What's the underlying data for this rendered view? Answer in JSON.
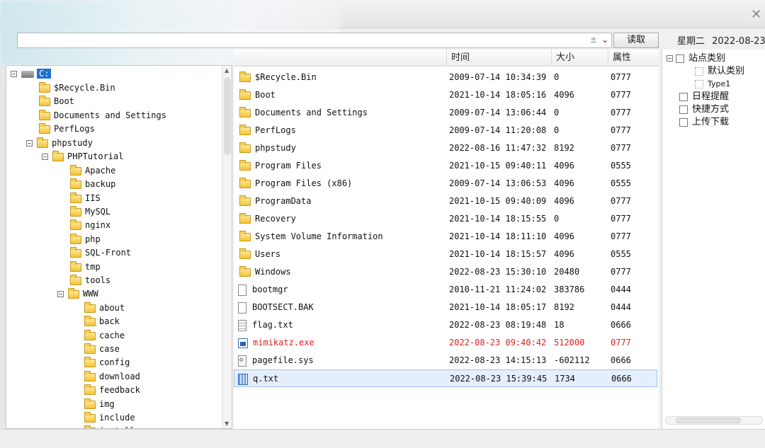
{
  "toolbar": {
    "read_label": "读取",
    "day": "星期二",
    "date": "2022-08-23"
  },
  "address": {
    "value": "",
    "controls": "±"
  },
  "tree": {
    "drive": "C:",
    "items": [
      {
        "label": "$Recycle.Bin"
      },
      {
        "label": "Boot"
      },
      {
        "label": "Documents and Settings"
      },
      {
        "label": "PerfLogs"
      },
      {
        "label": "phpstudy"
      },
      {
        "label": "PHPTutorial"
      },
      {
        "label": "Apache"
      },
      {
        "label": "backup"
      },
      {
        "label": "IIS"
      },
      {
        "label": "MySQL"
      },
      {
        "label": "nginx"
      },
      {
        "label": "php"
      },
      {
        "label": "SQL-Front"
      },
      {
        "label": "tmp"
      },
      {
        "label": "tools"
      },
      {
        "label": "WWW"
      },
      {
        "label": "about"
      },
      {
        "label": "back"
      },
      {
        "label": "cache"
      },
      {
        "label": "case"
      },
      {
        "label": "config"
      },
      {
        "label": "download"
      },
      {
        "label": "feedback"
      },
      {
        "label": "img"
      },
      {
        "label": "include"
      },
      {
        "label": "install"
      }
    ]
  },
  "list": {
    "columns": {
      "time": "时间",
      "size": "大小",
      "attr": "属性"
    },
    "rows": [
      {
        "name": "$Recycle.Bin",
        "time": "2009-07-14 10:34:39",
        "size": "0",
        "attr": "0777"
      },
      {
        "name": "Boot",
        "time": "2021-10-14 18:05:16",
        "size": "4096",
        "attr": "0777"
      },
      {
        "name": "Documents and Settings",
        "time": "2009-07-14 13:06:44",
        "size": "0",
        "attr": "0777"
      },
      {
        "name": "PerfLogs",
        "time": "2009-07-14 11:20:08",
        "size": "0",
        "attr": "0777"
      },
      {
        "name": "phpstudy",
        "time": "2022-08-16 11:47:32",
        "size": "8192",
        "attr": "0777"
      },
      {
        "name": "Program Files",
        "time": "2021-10-15 09:40:11",
        "size": "4096",
        "attr": "0555"
      },
      {
        "name": "Program Files (x86)",
        "time": "2009-07-14 13:06:53",
        "size": "4096",
        "attr": "0555"
      },
      {
        "name": "ProgramData",
        "time": "2021-10-15 09:40:09",
        "size": "4096",
        "attr": "0777"
      },
      {
        "name": "Recovery",
        "time": "2021-10-14 18:15:55",
        "size": "0",
        "attr": "0777"
      },
      {
        "name": "System Volume Information",
        "time": "2021-10-14 18:11:10",
        "size": "4096",
        "attr": "0777"
      },
      {
        "name": "Users",
        "time": "2021-10-14 18:15:57",
        "size": "4096",
        "attr": "0555"
      },
      {
        "name": "Windows",
        "time": "2022-08-23 15:30:10",
        "size": "20480",
        "attr": "0777"
      },
      {
        "name": "bootmgr",
        "time": "2010-11-21 11:24:02",
        "size": "383786",
        "attr": "0444"
      },
      {
        "name": "BOOTSECT.BAK",
        "time": "2021-10-14 18:05:17",
        "size": "8192",
        "attr": "0444"
      },
      {
        "name": "flag.txt",
        "time": "2022-08-23 08:19:48",
        "size": "18",
        "attr": "0666"
      },
      {
        "name": "mimikatz.exe",
        "time": "2022-08-23 09:40:42",
        "size": "512000",
        "attr": "0777"
      },
      {
        "name": "pagefile.sys",
        "time": "2022-08-23 14:15:13",
        "size": "-602112",
        "attr": "0666"
      },
      {
        "name": "q.txt",
        "time": "2022-08-23 15:39:45",
        "size": "1734",
        "attr": "0666"
      }
    ]
  },
  "right": {
    "site_category": "站点类别",
    "default_category": "默认类别",
    "type1": "Type1",
    "schedule": "日程提醒",
    "shortcut": "快捷方式",
    "upload_download": "上传下载"
  },
  "colors": {
    "highlight_red": "#e02020",
    "selection": "#e5eefc",
    "drive_label": "#1e6fd0"
  }
}
